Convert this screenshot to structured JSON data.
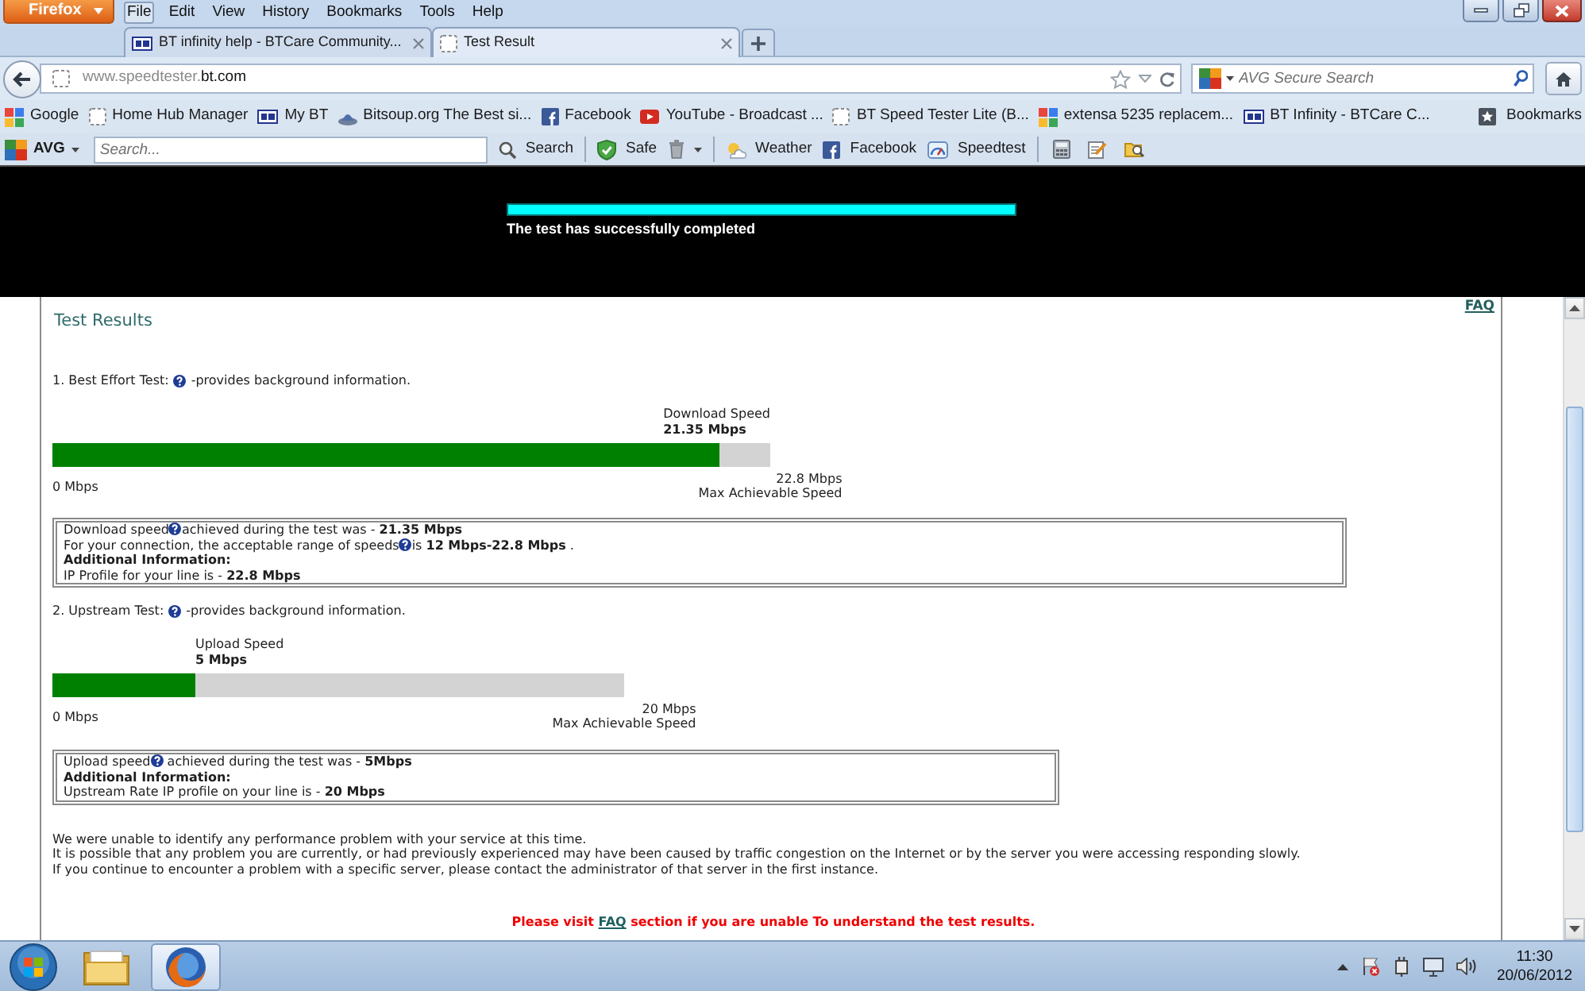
{
  "window": {
    "app_button": "Firefox",
    "menu": [
      {
        "label": "File",
        "selected": true
      },
      {
        "label": "Edit",
        "selected": false
      },
      {
        "label": "View",
        "selected": false
      },
      {
        "label": "History",
        "selected": false
      },
      {
        "label": "Bookmarks",
        "selected": false
      },
      {
        "label": "Tools",
        "selected": false
      },
      {
        "label": "Help",
        "selected": false
      }
    ]
  },
  "tabs": [
    {
      "title": "BT infinity help - BTCare Community...",
      "kind": "bt",
      "selected": false
    },
    {
      "title": "Test Result",
      "kind": "blank",
      "selected": true
    }
  ],
  "address_bar": {
    "url_host": "www.speedtester.",
    "url_domain": "bt.com"
  },
  "search_field": {
    "placeholder": "AVG Secure Search"
  },
  "bookmarks": {
    "items": [
      {
        "label": "Google",
        "kind": "tiles"
      },
      {
        "label": "Home Hub Manager",
        "kind": "blank"
      },
      {
        "label": "My BT",
        "kind": "bt"
      },
      {
        "label": "Bitsoup.org The Best si...",
        "kind": "dome"
      },
      {
        "label": "Facebook",
        "kind": "facebook"
      },
      {
        "label": "YouTube - Broadcast ...",
        "kind": "youtube"
      },
      {
        "label": "BT Speed Tester Lite (B...",
        "kind": "blank"
      },
      {
        "label": "extensa 5235 replacem...",
        "kind": "tiles"
      },
      {
        "label": "BT Infinity - BTCare C...",
        "kind": "bt"
      }
    ],
    "menu": "Bookmarks"
  },
  "avg_toolbar": {
    "brand": "AVG",
    "search_placeholder": "Search...",
    "items": [
      {
        "kind": "search",
        "label": "Search"
      },
      {
        "kind": "separator"
      },
      {
        "kind": "shield",
        "label": "Safe"
      },
      {
        "kind": "trash"
      },
      {
        "kind": "separator"
      },
      {
        "kind": "weather",
        "label": "Weather"
      },
      {
        "kind": "facebook",
        "label": "Facebook"
      },
      {
        "kind": "gauge",
        "label": "Speedtest"
      },
      {
        "kind": "separator"
      },
      {
        "kind": "calculator"
      },
      {
        "kind": "notepad"
      },
      {
        "kind": "folder"
      }
    ]
  },
  "speed_test": {
    "level": 1,
    "message": "The test has successfully completed"
  },
  "results": {
    "title": "Test Results",
    "faq_link": "FAQ",
    "tests": [
      {
        "heading": "1. Best Effort Test:",
        "note": "-provides background information.",
        "speed_label": "Download Speed",
        "speed_value": "21.35 Mbps",
        "level": 0.93,
        "scale_min": "0 Mbps",
        "scale_max": "22.8 Mbps",
        "scale_caption": "Max Achievable Speed",
        "info": [
          {
            "kind": "help",
            "text": "Download speed",
            "rest": "achieved during the test was - **21.35 Mbps**"
          },
          {
            "kind": "help",
            "text": "For your connection, the acceptable range of speeds",
            "rest": "is **12 Mbps-22.8 Mbps** ."
          },
          {
            "kind": "heading",
            "text": "Additional Information:"
          },
          {
            "kind": "text",
            "text": "IP Profile for your line is - **22.8 Mbps**"
          }
        ]
      },
      {
        "heading": "2. Upstream Test:",
        "note": "-provides background information.",
        "speed_label": "Upload Speed",
        "speed_value": "5 Mbps",
        "level": 0.25,
        "scale_min": "0 Mbps",
        "scale_max": "20 Mbps",
        "scale_caption": "Max Achievable Speed",
        "info": [
          {
            "kind": "help",
            "text": "Upload speed",
            "rest": " achieved during the test was - **5Mbps**"
          },
          {
            "kind": "heading",
            "text": "Additional Information:"
          },
          {
            "kind": "text",
            "text": "Upstream Rate IP profile on your line is - **20 Mbps**"
          }
        ]
      }
    ],
    "notes": [
      "We were unable to identify any performance problem with your service at this time.",
      "It is possible that any problem you are currently, or had previously experienced may have been caused by traffic congestion on the Internet or by the server you were accessing responding slowly.",
      "If you continue to encounter a problem with a specific server, please contact the administrator of that server in the first instance."
    ],
    "footer": {
      "before": "Please visit",
      "link": "FAQ",
      "after": "section if you are unable To understand the test results."
    }
  },
  "taskbar": {
    "apps": [
      {
        "kind": "folder",
        "selected": false
      },
      {
        "kind": "browser",
        "selected": true
      }
    ],
    "time": "11:30",
    "date": "20/06/2012"
  }
}
